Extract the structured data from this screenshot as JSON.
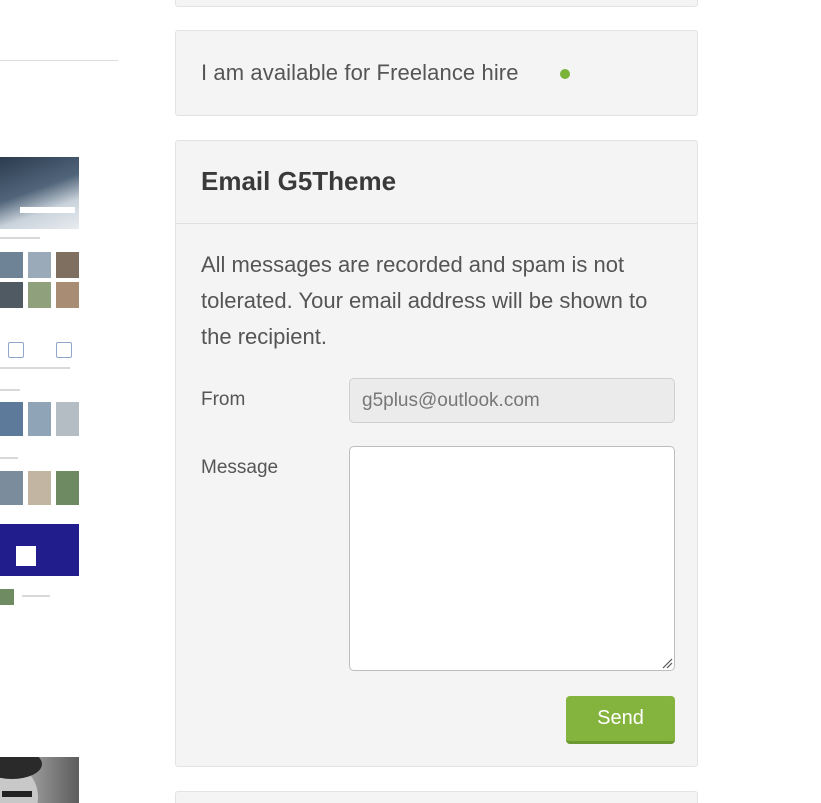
{
  "freelance": {
    "text": "I am available for Freelance hire",
    "status_color": "#7ab43a"
  },
  "email_form": {
    "title": "Email G5Theme",
    "note": "All messages are recorded and spam is not tolerated. Your email address will be shown to the recipient.",
    "from_label": "From",
    "from_value": "g5plus@outlook.com",
    "message_label": "Message",
    "message_value": "",
    "send_label": "Send"
  },
  "colors": {
    "accent": "#84b43e",
    "panel_bg": "#f4f4f4"
  }
}
